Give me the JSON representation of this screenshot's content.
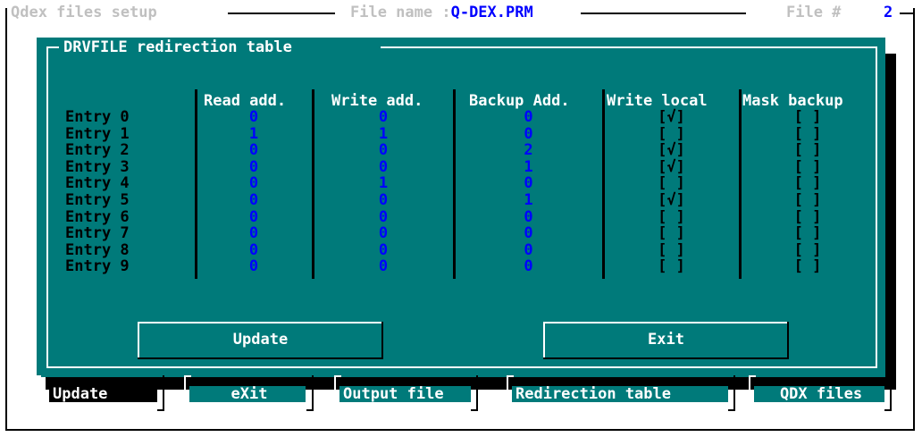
{
  "titlebar": {
    "app_title": "Qdex files setup",
    "file_name_label": "File name :",
    "file_name_value": "Q-DEX.PRM",
    "file_no_label": "File #",
    "file_no_value": "2"
  },
  "dialog": {
    "title": "DRVFILE redirection table",
    "columns": [
      "Read add.",
      "Write add.",
      "Backup Add.",
      "Write local",
      "Mask backup"
    ],
    "rows": [
      {
        "label": "Entry 0",
        "read": "0",
        "write": "0",
        "backup": "0",
        "write_local": "[√]",
        "mask_backup": "[ ]"
      },
      {
        "label": "Entry 1",
        "read": "1",
        "write": "1",
        "backup": "0",
        "write_local": "[ ]",
        "mask_backup": "[ ]"
      },
      {
        "label": "Entry 2",
        "read": "0",
        "write": "0",
        "backup": "2",
        "write_local": "[√]",
        "mask_backup": "[ ]"
      },
      {
        "label": "Entry 3",
        "read": "0",
        "write": "0",
        "backup": "1",
        "write_local": "[√]",
        "mask_backup": "[ ]"
      },
      {
        "label": "Entry 4",
        "read": "0",
        "write": "1",
        "backup": "0",
        "write_local": "[ ]",
        "mask_backup": "[ ]"
      },
      {
        "label": "Entry 5",
        "read": "0",
        "write": "0",
        "backup": "1",
        "write_local": "[√]",
        "mask_backup": "[ ]"
      },
      {
        "label": "Entry 6",
        "read": "0",
        "write": "0",
        "backup": "0",
        "write_local": "[ ]",
        "mask_backup": "[ ]"
      },
      {
        "label": "Entry 7",
        "read": "0",
        "write": "0",
        "backup": "0",
        "write_local": "[ ]",
        "mask_backup": "[ ]"
      },
      {
        "label": "Entry 8",
        "read": "0",
        "write": "0",
        "backup": "0",
        "write_local": "[ ]",
        "mask_backup": "[ ]"
      },
      {
        "label": "Entry 9",
        "read": "0",
        "write": "0",
        "backup": "0",
        "write_local": "[ ]",
        "mask_backup": "[ ]"
      }
    ],
    "update_button": "Update",
    "exit_button": "Exit"
  },
  "menubar": {
    "items": [
      "Update",
      "eXit",
      "Output file",
      "Redirection table",
      "QDX files"
    ]
  },
  "colors": {
    "dialog_bg": "#007a7a",
    "value_text": "#0000ff",
    "header_text": "#ffffff",
    "title_text": "#c0c0c0"
  }
}
